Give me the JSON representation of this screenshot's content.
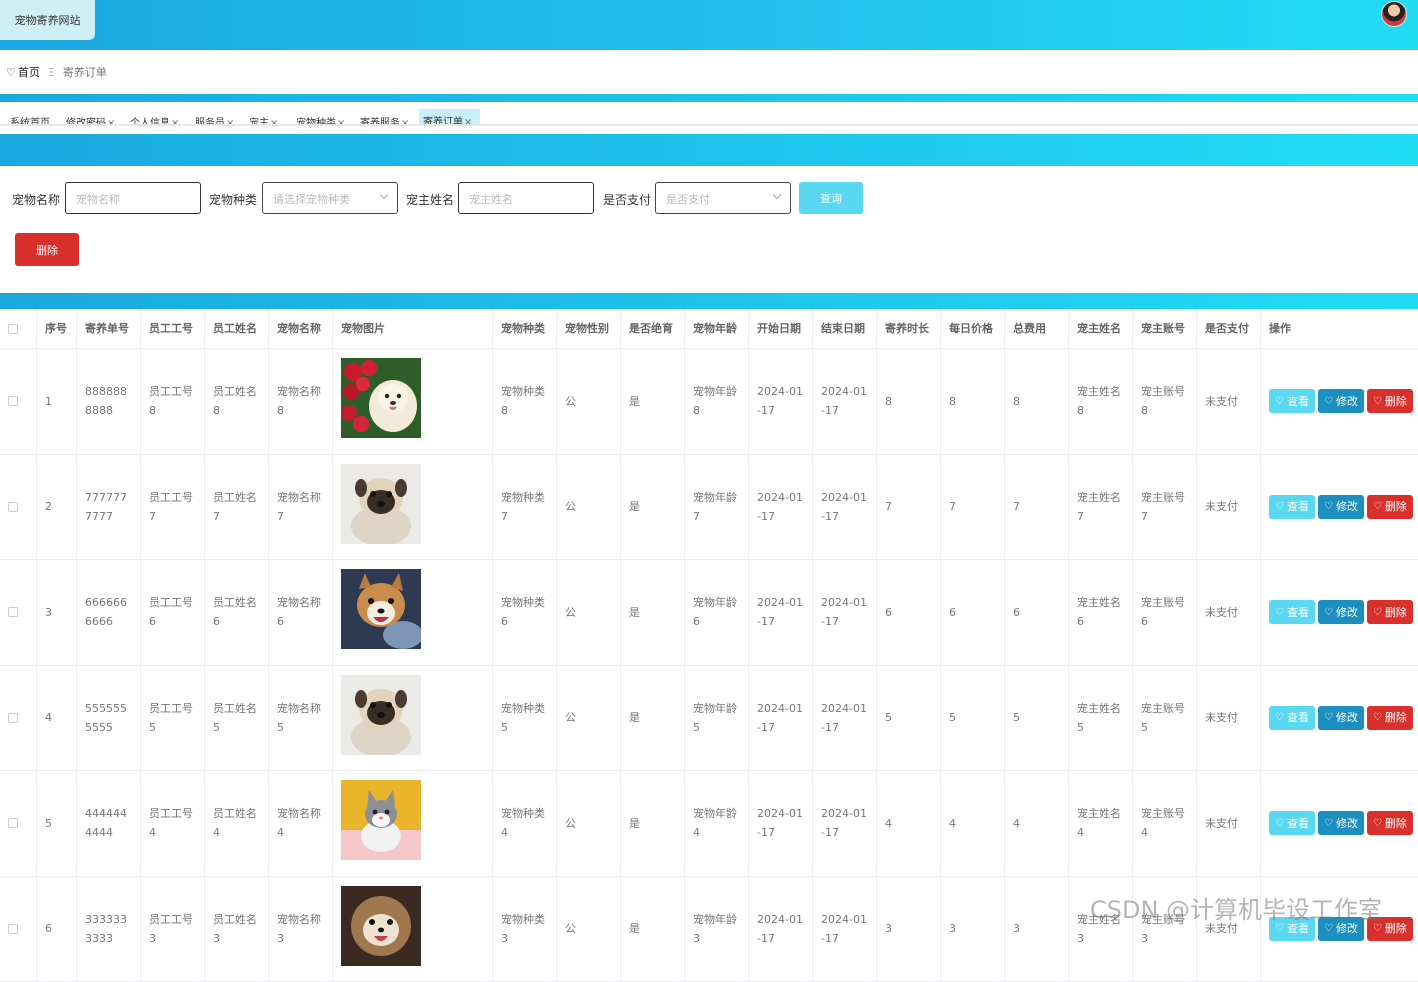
{
  "header": {
    "site_title": "宠物寄养网站"
  },
  "breadcrumb": {
    "home": "首页",
    "separator": "Ξ",
    "current": "寄养订单"
  },
  "tabs": [
    {
      "label": "系统首页",
      "closable": false
    },
    {
      "label": "修改密码",
      "closable": true
    },
    {
      "label": "个人信息",
      "closable": true
    },
    {
      "label": "服务员",
      "closable": true
    },
    {
      "label": "宠主",
      "closable": true
    },
    {
      "label": "宠物种类",
      "closable": true
    },
    {
      "label": "寄养服务",
      "closable": true
    },
    {
      "label": "寄养订单",
      "closable": true,
      "active": true
    }
  ],
  "filters": {
    "pet_name_label": "宠物名称",
    "pet_name_placeholder": "宠物名称",
    "pet_type_label": "宠物种类",
    "pet_type_placeholder": "请选择宠物种类",
    "owner_name_label": "宠主姓名",
    "owner_name_placeholder": "宠主姓名",
    "paid_label": "是否支付",
    "paid_placeholder": "是否支付",
    "query_label": "查询",
    "delete_label": "删除"
  },
  "table": {
    "headers": [
      "序号",
      "寄养单号",
      "员工工号",
      "员工姓名",
      "宠物名称",
      "宠物图片",
      "宠物种类",
      "宠物性别",
      "是否绝育",
      "宠物年龄",
      "开始日期",
      "结束日期",
      "寄养时长",
      "每日价格",
      "总费用",
      "宠主姓名",
      "宠主账号",
      "是否支付",
      "操作"
    ],
    "actions": {
      "view": "查看",
      "edit": "修改",
      "delete": "删除"
    },
    "rows": [
      {
        "idx": "1",
        "order": "8888888888",
        "emp_no": "员工工号8",
        "emp_name": "员工姓名8",
        "pet_name": "宠物名称8",
        "pet_type": "宠物种类8",
        "gender": "公",
        "neutered": "是",
        "age": "宠物年龄8",
        "start": "2024-01-17",
        "end": "2024-01-17",
        "duration": "8",
        "daily": "8",
        "total": "8",
        "owner_name": "宠主姓名8",
        "owner_acct": "宠主账号8",
        "paid": "未支付",
        "img": "dog-roses"
      },
      {
        "idx": "2",
        "order": "7777777777",
        "emp_no": "员工工号7",
        "emp_name": "员工姓名7",
        "pet_name": "宠物名称7",
        "pet_type": "宠物种类7",
        "gender": "公",
        "neutered": "是",
        "age": "宠物年龄7",
        "start": "2024-01-17",
        "end": "2024-01-17",
        "duration": "7",
        "daily": "7",
        "total": "7",
        "owner_name": "宠主姓名7",
        "owner_acct": "宠主账号7",
        "paid": "未支付",
        "img": "pug"
      },
      {
        "idx": "3",
        "order": "6666666666",
        "emp_no": "员工工号6",
        "emp_name": "员工姓名6",
        "pet_name": "宠物名称6",
        "pet_type": "宠物种类6",
        "gender": "公",
        "neutered": "是",
        "age": "宠物年龄6",
        "start": "2024-01-17",
        "end": "2024-01-17",
        "duration": "6",
        "daily": "6",
        "total": "6",
        "owner_name": "宠主姓名6",
        "owner_acct": "宠主账号6",
        "paid": "未支付",
        "img": "corgi"
      },
      {
        "idx": "4",
        "order": "5555555555",
        "emp_no": "员工工号5",
        "emp_name": "员工姓名5",
        "pet_name": "宠物名称5",
        "pet_type": "宠物种类5",
        "gender": "公",
        "neutered": "是",
        "age": "宠物年龄5",
        "start": "2024-01-17",
        "end": "2024-01-17",
        "duration": "5",
        "daily": "5",
        "total": "5",
        "owner_name": "宠主姓名5",
        "owner_acct": "宠主账号5",
        "paid": "未支付",
        "img": "pug"
      },
      {
        "idx": "5",
        "order": "4444444444",
        "emp_no": "员工工号4",
        "emp_name": "员工姓名4",
        "pet_name": "宠物名称4",
        "pet_type": "宠物种类4",
        "gender": "公",
        "neutered": "是",
        "age": "宠物年龄4",
        "start": "2024-01-17",
        "end": "2024-01-17",
        "duration": "4",
        "daily": "4",
        "total": "4",
        "owner_name": "宠主姓名4",
        "owner_acct": "宠主账号4",
        "paid": "未支付",
        "img": "kitten"
      },
      {
        "idx": "6",
        "order": "3333333333",
        "emp_no": "员工工号3",
        "emp_name": "员工姓名3",
        "pet_name": "宠物名称3",
        "pet_type": "宠物种类3",
        "gender": "公",
        "neutered": "是",
        "age": "宠物年龄3",
        "start": "2024-01-17",
        "end": "2024-01-17",
        "duration": "3",
        "daily": "3",
        "total": "3",
        "owner_name": "宠主姓名3",
        "owner_acct": "宠主账号3",
        "paid": "未支付",
        "img": "shihtzu"
      }
    ]
  },
  "watermark": "CSDN @计算机毕设工作室",
  "colors": {
    "header_gradient_start": "#1aa8e0",
    "header_gradient_end": "#22dcf6",
    "query_button": "#5ad8f2",
    "delete_button": "#d9302c",
    "edit_button": "#1b8fbf"
  }
}
